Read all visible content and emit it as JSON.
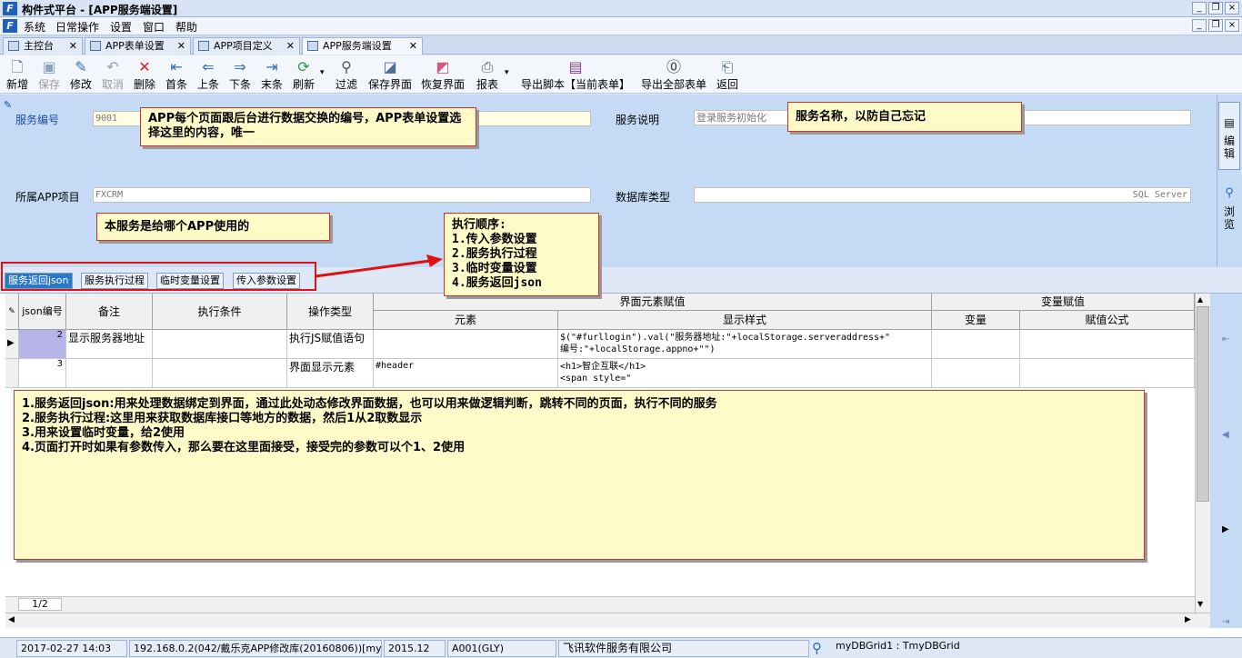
{
  "window": {
    "title": "构件式平台 - [APP服务端设置]"
  },
  "menu": [
    "系统",
    "日常操作",
    "设置",
    "窗口",
    "帮助"
  ],
  "doc_tabs": [
    {
      "label": "主控台"
    },
    {
      "label": "APP表单设置"
    },
    {
      "label": "APP项目定义"
    },
    {
      "label": "APP服务端设置"
    }
  ],
  "toolbar": [
    {
      "label": "新增",
      "icon": "new-icon"
    },
    {
      "label": "保存",
      "icon": "save-icon"
    },
    {
      "label": "修改",
      "icon": "edit-icon"
    },
    {
      "label": "取消",
      "icon": "undo-icon"
    },
    {
      "label": "删除",
      "icon": "delete-icon"
    },
    {
      "label": "首条",
      "icon": "first-icon"
    },
    {
      "label": "上条",
      "icon": "prev-icon"
    },
    {
      "label": "下条",
      "icon": "next-icon"
    },
    {
      "label": "末条",
      "icon": "last-icon"
    },
    {
      "label": "刷新",
      "icon": "refresh-icon"
    },
    {
      "label": "过滤",
      "icon": "filter-icon"
    },
    {
      "label": "保存界面",
      "icon": "save-layout-icon"
    },
    {
      "label": "恢复界面",
      "icon": "restore-layout-icon"
    },
    {
      "label": "报表",
      "icon": "printer-icon"
    },
    {
      "label": "导出脚本【当前表单】",
      "icon": "export-script-icon"
    },
    {
      "label": "导出全部表单",
      "icon": "export-all-icon"
    },
    {
      "label": "返回",
      "icon": "exit-icon"
    }
  ],
  "form": {
    "service_no_label": "服务编号",
    "service_no_value": "9001",
    "service_desc_label": "服务说明",
    "service_desc_value": "登录服务初始化",
    "app_project_label": "所属APP项目",
    "app_project_value": "FXCRM",
    "db_type_label": "数据库类型",
    "db_type_value": "SQL Server"
  },
  "side": {
    "edit_label": "编辑",
    "browse_label": "浏览"
  },
  "callouts": {
    "c1": "APP每个页面跟后台进行数据交换的编号，APP表单设置选择这里的内容，唯一",
    "c2": "服务名称，以防自己忘记",
    "c3": "本服务是给哪个APP使用的",
    "c4": [
      "执行顺序:",
      "1.传入参数设置",
      "2.服务执行过程",
      "3.临时变量设置",
      "4.服务返回json"
    ],
    "c5": [
      "1.服务返回json:用来处理数据绑定到界面，通过此处动态修改界面数据，也可以用来做逻辑判断，跳转不同的页面，执行不同的服务",
      "2.服务执行过程:这里用来获取数据库接口等地方的数据，然后1从2取数显示",
      "3.用来设置临时变量，给2使用",
      "4.页面打开时如果有参数传入，那么要在这里面接受，接受完的参数可以个1、2使用"
    ]
  },
  "sub_tabs": [
    "服务返回json",
    "服务执行过程",
    "临时变量设置",
    "传入参数设置"
  ],
  "grid": {
    "headers": {
      "no": "json编号",
      "remark": "备注",
      "cond": "执行条件",
      "optype": "操作类型",
      "ui_group": "界面元素赋值",
      "element": "元素",
      "style": "显示样式",
      "var_group": "变量赋值",
      "var": "变量",
      "formula": "赋值公式"
    },
    "rows": [
      {
        "no": "2",
        "remark": "显示服务器地址",
        "cond": "",
        "optype": "执行JS赋值语句",
        "element": "",
        "style": [
          "$(\"#furllogin\").val(\"服务器地址:\"+localStorage.serveraddress+\"",
          "编号:\"+localStorage.appno+\"\")"
        ],
        "var": "",
        "formula": ""
      },
      {
        "no": "3",
        "remark": "",
        "cond": "",
        "optype": "界面显示元素",
        "element": "#header",
        "style": [
          "<h1>智企互联</h1>",
          "<span   style=\""
        ],
        "var": "",
        "formula": ""
      }
    ],
    "pager": "1/2"
  },
  "status": {
    "datetime": "2017-02-27 14:03",
    "server": "192.168.0.2(042/戴乐克APP修改库(20160806))[mye",
    "version": "2015.12",
    "user": "A001(GLY)",
    "company": "飞讯软件服务有限公司",
    "component": "myDBGrid1 : TmyDBGrid"
  }
}
